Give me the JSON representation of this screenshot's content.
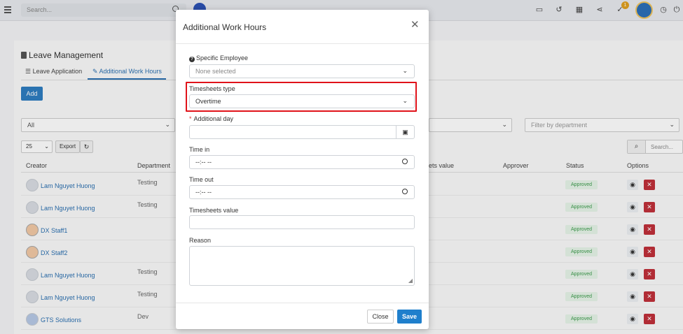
{
  "topbar": {
    "search_placeholder": "Search...",
    "notification_count": "1",
    "icons": [
      "menu-icon",
      "search-icon",
      "id-card-icon",
      "history-icon",
      "grid-icon",
      "share-icon",
      "check-icon",
      "clock-icon",
      "power-icon"
    ]
  },
  "page": {
    "title": "Leave Management",
    "tabs": [
      {
        "label": "Leave Application",
        "active": false
      },
      {
        "label": "Additional Work Hours",
        "active": true
      }
    ],
    "add_label": "Add",
    "filters": {
      "first": "All",
      "department_placeholder": "Filter by department"
    },
    "page_size": "25",
    "export_label": "Export",
    "search_placeholder": "Search...",
    "columns": {
      "creator": "Creator",
      "department": "Department",
      "value": "ets value",
      "approver": "Approver",
      "status": "Status",
      "options": "Options"
    },
    "rows": [
      {
        "name": "Lam Nguyet Huong",
        "department": "Testing",
        "status": "Approved"
      },
      {
        "name": "Lam Nguyet Huong",
        "department": "Testing",
        "status": "Approved"
      },
      {
        "name": "DX Staff1",
        "department": "",
        "status": "Approved"
      },
      {
        "name": "DX Staff2",
        "department": "",
        "status": "Approved"
      },
      {
        "name": "Lam Nguyet Huong",
        "department": "Testing",
        "status": "Approved"
      },
      {
        "name": "Lam Nguyet Huong",
        "department": "Testing",
        "status": "Approved"
      },
      {
        "name": "GTS Solutions",
        "department": "Dev",
        "status": "Approved"
      }
    ]
  },
  "modal": {
    "title": "Additional Work Hours",
    "specific_employee": {
      "label": "Specific Employee",
      "value": "None selected"
    },
    "timesheets_type": {
      "label": "Timesheets type",
      "value": "Overtime"
    },
    "additional_day": {
      "label": "Additional day",
      "value": ""
    },
    "time_in": {
      "label": "Time in",
      "value": "--:-- --"
    },
    "time_out": {
      "label": "Time out",
      "value": "--:-- --"
    },
    "timesheets_value": {
      "label": "Timesheets value",
      "value": ""
    },
    "reason": {
      "label": "Reason",
      "value": ""
    },
    "close_label": "Close",
    "save_label": "Save"
  },
  "colors": {
    "accent": "#2e7dc0",
    "save": "#1f7fcc",
    "highlight": "#e0131a",
    "danger": "#c0303a",
    "approved_bg": "#e7f5e9",
    "approved_text": "#3a9a4a"
  }
}
